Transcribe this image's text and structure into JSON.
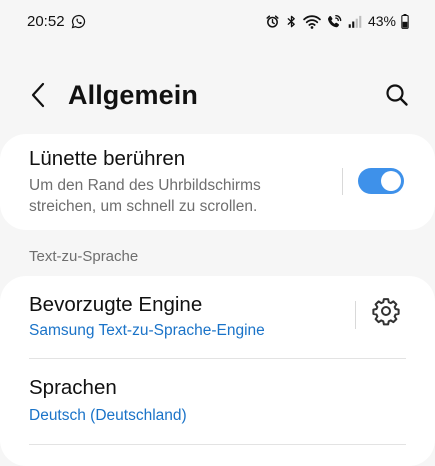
{
  "status_bar": {
    "time": "20:52",
    "battery": "43%"
  },
  "header": {
    "title": "Allgemein"
  },
  "bezel": {
    "title": "Lünette berühren",
    "description_line1": "Um den Rand des Uhrbildschirms",
    "description_line2": "streichen, um schnell zu scrollen.",
    "toggle_on": true
  },
  "tts": {
    "section_title": "Text-zu-Sprache",
    "engine": {
      "title": "Bevorzugte Engine",
      "value": "Samsung Text-zu-Sprache-Engine"
    },
    "language": {
      "title": "Sprachen",
      "value": "Deutsch (Deutschland)"
    }
  },
  "colors": {
    "accent": "#1a73c8",
    "toggle": "#3e91ea",
    "background": "#f6f6f6",
    "card": "#ffffff"
  }
}
